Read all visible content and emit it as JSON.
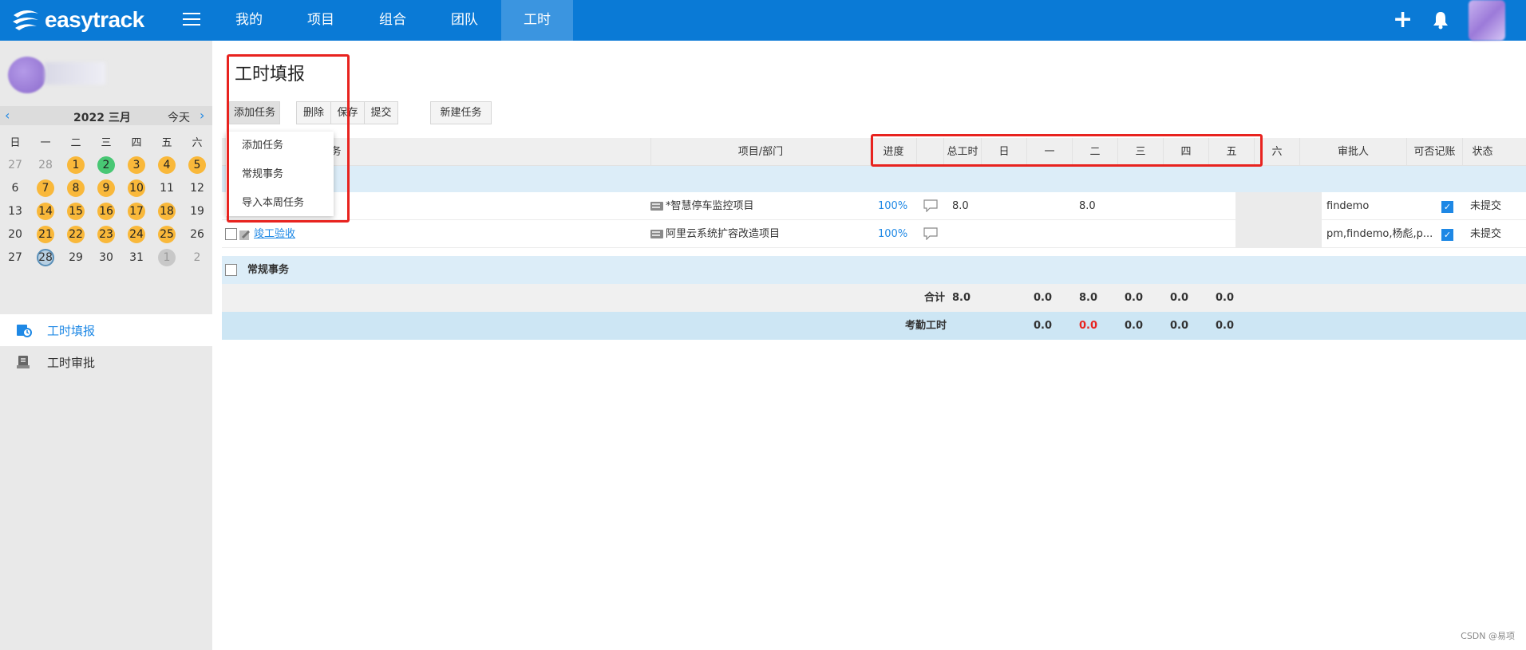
{
  "brand": {
    "name": "easytrack"
  },
  "nav": {
    "tabs": [
      "我的",
      "项目",
      "组合",
      "团队",
      "工时"
    ],
    "active": "工时"
  },
  "calendar": {
    "title": "2022 三月",
    "today_label": "今天",
    "prev": "‹",
    "next": "›",
    "weekdays": [
      "日",
      "一",
      "二",
      "三",
      "四",
      "五",
      "六"
    ],
    "weeks": [
      [
        {
          "d": "27",
          "s": "muted"
        },
        {
          "d": "28",
          "s": "muted"
        },
        {
          "d": "1",
          "s": "orange"
        },
        {
          "d": "2",
          "s": "green"
        },
        {
          "d": "3",
          "s": "orange"
        },
        {
          "d": "4",
          "s": "orange"
        },
        {
          "d": "5",
          "s": "orange"
        }
      ],
      [
        {
          "d": "6",
          "s": ""
        },
        {
          "d": "7",
          "s": "orange"
        },
        {
          "d": "8",
          "s": "orange"
        },
        {
          "d": "9",
          "s": "orange"
        },
        {
          "d": "10",
          "s": "orange"
        },
        {
          "d": "11",
          "s": ""
        },
        {
          "d": "12",
          "s": ""
        }
      ],
      [
        {
          "d": "13",
          "s": ""
        },
        {
          "d": "14",
          "s": "orange"
        },
        {
          "d": "15",
          "s": "orange"
        },
        {
          "d": "16",
          "s": "orange"
        },
        {
          "d": "17",
          "s": "orange"
        },
        {
          "d": "18",
          "s": "orange"
        },
        {
          "d": "19",
          "s": ""
        }
      ],
      [
        {
          "d": "20",
          "s": ""
        },
        {
          "d": "21",
          "s": "orange"
        },
        {
          "d": "22",
          "s": "orange"
        },
        {
          "d": "23",
          "s": "orange"
        },
        {
          "d": "24",
          "s": "orange"
        },
        {
          "d": "25",
          "s": "orange"
        },
        {
          "d": "26",
          "s": ""
        }
      ],
      [
        {
          "d": "27",
          "s": ""
        },
        {
          "d": "28",
          "s": "today"
        },
        {
          "d": "29",
          "s": ""
        },
        {
          "d": "30",
          "s": ""
        },
        {
          "d": "31",
          "s": ""
        },
        {
          "d": "1",
          "s": "grey"
        },
        {
          "d": "2",
          "s": "muted"
        }
      ]
    ]
  },
  "side_menu": {
    "timesheet": "工时填报",
    "approval": "工时审批"
  },
  "page": {
    "title": "工时填报"
  },
  "toolbar": {
    "add_task": "添加任务",
    "delete": "删除",
    "save": "保存",
    "submit": "提交",
    "new_task": "新建任务"
  },
  "dropdown": {
    "items": [
      "添加任务",
      "常规事务",
      "导入本周任务"
    ]
  },
  "table": {
    "headers": {
      "task": "务",
      "project": "项目/部门",
      "progress": "进度",
      "total": "总工时",
      "sun": "日",
      "mon": "一",
      "tue": "二",
      "wed": "三",
      "thu": "四",
      "fri": "五",
      "sat": "六",
      "approver": "审批人",
      "billable": "可否记账",
      "status": "状态"
    },
    "rows": [
      {
        "task": "",
        "project": "*智慧停车监控项目",
        "progress": "100%",
        "total": "8.0",
        "mon": "8.0",
        "approver": "findemo",
        "billable": true,
        "status": "未提交"
      },
      {
        "task": "竣工验收",
        "project": "阿里云系统扩容改造项目",
        "progress": "100%",
        "total": "",
        "mon": "",
        "approver": "pm,findemo,杨彪,p...",
        "billable": true,
        "status": "未提交"
      }
    ],
    "routine_group": "常规事务",
    "sum": {
      "label": "合计",
      "values": [
        "8.0",
        "0.0",
        "8.0",
        "0.0",
        "0.0",
        "0.0"
      ]
    },
    "attendance": {
      "label": "考勤工时",
      "values": [
        "0.0",
        "0.0",
        "0.0",
        "0.0",
        "0.0"
      ]
    }
  },
  "colors": {
    "primary": "#0a7ad6",
    "accent": "#1e88e5",
    "highlight": "#e8231f",
    "calendar_marked": "#f9b83a",
    "calendar_done": "#48c774"
  },
  "watermark": "CSDN @易项"
}
